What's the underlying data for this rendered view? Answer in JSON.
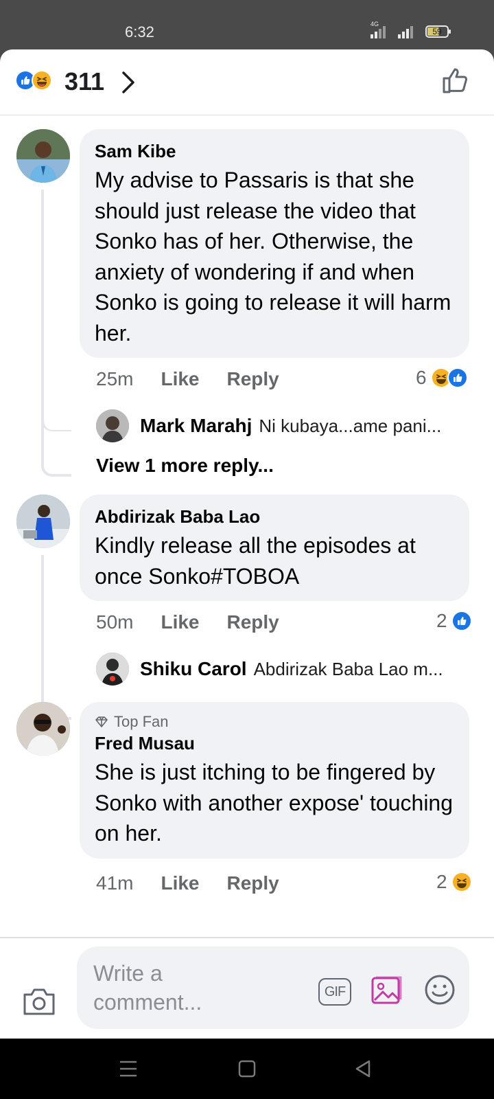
{
  "status": {
    "time": "6:32",
    "network": "4G",
    "battery": "59"
  },
  "reactions": {
    "count": "311",
    "icons": [
      "like-icon",
      "haha-icon"
    ]
  },
  "comments": [
    {
      "author": "Sam Kibe",
      "badge": "",
      "text": "My advise to Passaris is that she should just release the video that Sonko has of her. Otherwise, the anxiety of wondering if and when Sonko is going to release it will harm her.",
      "time": "25m",
      "like_label": "Like",
      "reply_label": "Reply",
      "reaction_count": "6",
      "reaction_icons": [
        "haha-icon",
        "like-icon"
      ],
      "replies": [
        {
          "author": "Mark Marahj",
          "text": "Ni kubaya...ame pani..."
        }
      ],
      "view_more": "View 1 more reply..."
    },
    {
      "author": "Abdirizak Baba Lao",
      "badge": "",
      "text": "Kindly release all the episodes at once Sonko#TOBOA",
      "time": "50m",
      "like_label": "Like",
      "reply_label": "Reply",
      "reaction_count": "2",
      "reaction_icons": [
        "like-icon"
      ],
      "replies": [
        {
          "author": "Shiku Carol",
          "text": "Abdirizak Baba Lao m..."
        }
      ]
    },
    {
      "author": "Fred Musau",
      "badge": "Top Fan",
      "text": "She is just itching to be fingered by Sonko with another expose' touching on her.",
      "time": "41m",
      "like_label": "Like",
      "reply_label": "Reply",
      "reaction_count": "2",
      "reaction_icons": [
        "haha-icon"
      ]
    }
  ],
  "composer": {
    "placeholder": "Write a comment...",
    "gif_label": "GIF"
  },
  "colors": {
    "accent": "#1b74e4",
    "haha": "#f7b125",
    "bubble": "#f0f2f5",
    "muted": "#65676b",
    "photo_icon": "#c13aa5"
  }
}
